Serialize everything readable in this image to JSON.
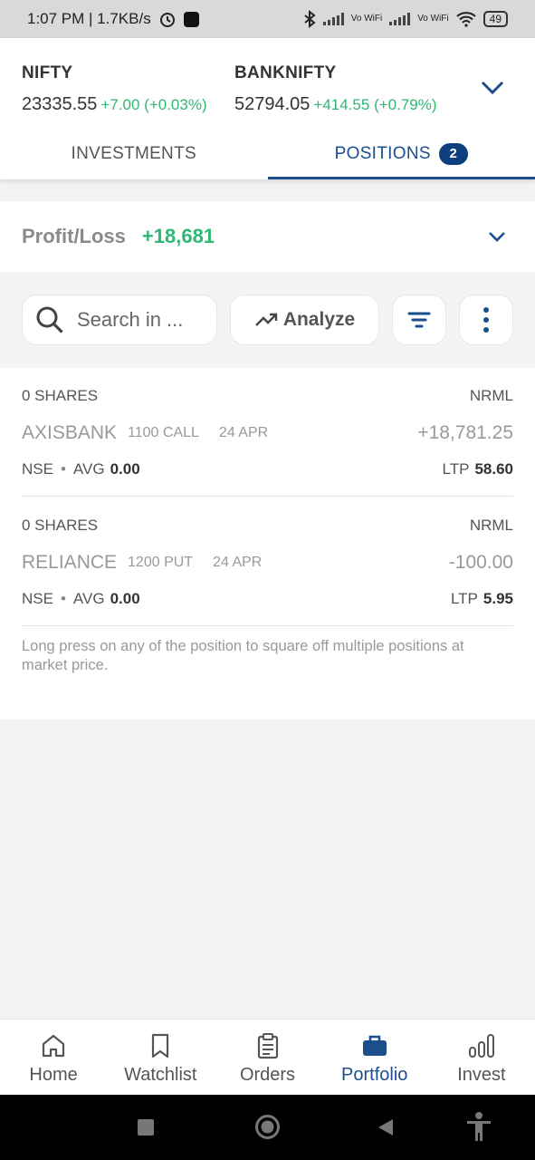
{
  "status_bar": {
    "time_speed": "1:07 PM | 1.7KB/s",
    "battery": "49",
    "vo_wifi_1": "Vo WiFi",
    "vo_wifi_2": "Vo WiFi"
  },
  "indices": [
    {
      "name": "NIFTY",
      "value": "23335.55",
      "change": "+7.00 (+0.03%)"
    },
    {
      "name": "BANKNIFTY",
      "value": "52794.05",
      "change": "+414.55 (+0.79%)"
    }
  ],
  "tabs": [
    {
      "label": "INVESTMENTS",
      "active": false
    },
    {
      "label": "POSITIONS",
      "badge": "2",
      "active": true
    }
  ],
  "pl": {
    "label": "Profit/Loss",
    "value": "+18,681"
  },
  "toolbar": {
    "search_placeholder": "Search in ...",
    "analyze_label": "Analyze"
  },
  "positions": [
    {
      "shares": "0 SHARES",
      "product": "NRML",
      "symbol": "AXISBANK",
      "strike": "1100 CALL",
      "expiry": "24 APR",
      "pnl": "+18,781.25",
      "exchange": "NSE",
      "avg_label": "AVG",
      "avg": "0.00",
      "ltp_label": "LTP",
      "ltp": "58.60"
    },
    {
      "shares": "0 SHARES",
      "product": "NRML",
      "symbol": "RELIANCE",
      "strike": "1200 PUT",
      "expiry": "24 APR",
      "pnl": "-100.00",
      "exchange": "NSE",
      "avg_label": "AVG",
      "avg": "0.00",
      "ltp_label": "LTP",
      "ltp": "5.95"
    }
  ],
  "hint": "Long press on any of the position to square off multiple positions at market price.",
  "bottom_nav": [
    {
      "label": "Home",
      "icon": "home-icon"
    },
    {
      "label": "Watchlist",
      "icon": "bookmark-icon"
    },
    {
      "label": "Orders",
      "icon": "clipboard-icon"
    },
    {
      "label": "Portfolio",
      "icon": "briefcase-icon",
      "active": true
    },
    {
      "label": "Invest",
      "icon": "bar-chart-icon"
    }
  ],
  "colors": {
    "accent": "#1a4e8c",
    "positive": "#2eb872",
    "badge": "#0d3f7f"
  }
}
